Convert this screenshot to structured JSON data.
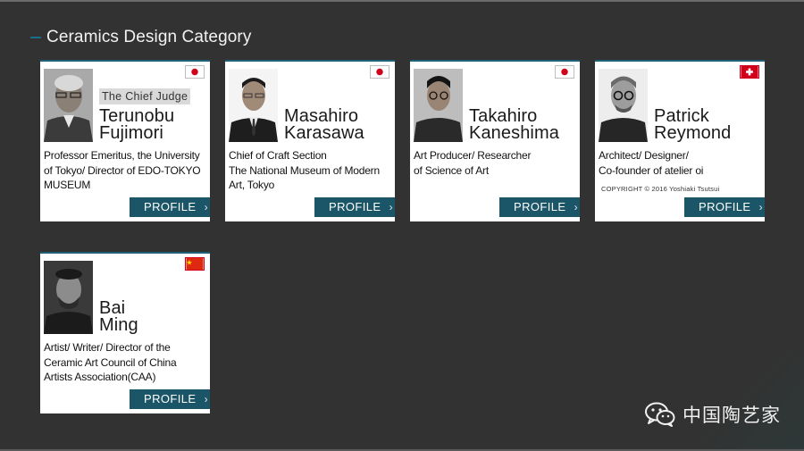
{
  "section": {
    "title": "Ceramics Design Category"
  },
  "cards": [
    {
      "country": "Japan",
      "tag": "The Chief Judge",
      "name_line1": "Terunobu",
      "name_line2": "Fujimori",
      "desc": [
        "Professor Emeritus, the University",
        "of Tokyo/ Director of EDO-TOKYO",
        "MUSEUM"
      ],
      "button": "PROFILE"
    },
    {
      "country": "Japan",
      "name_line1": "Masahiro",
      "name_line2": "Karasawa",
      "desc": [
        "Chief of Craft Section",
        "The National Museum of Modern",
        "Art, Tokyo"
      ],
      "button": "PROFILE"
    },
    {
      "country": "Japan",
      "name_line1": "Takahiro",
      "name_line2": "Kaneshima",
      "desc": [
        "Art Producer/ Researcher",
        "of Science of Art"
      ],
      "button": "PROFILE"
    },
    {
      "country": "Switzerland",
      "name_line1": "Patrick",
      "name_line2": "Reymond",
      "desc": [
        "Architect/ Designer/",
        "Co-founder of atelier oi"
      ],
      "copyright": "COPYRIGHT © 2016 Yoshiaki Tsutsui",
      "button": "PROFILE"
    },
    {
      "country": "China",
      "name_line1": "Bai",
      "name_line2": "Ming",
      "desc": [
        "Artist/ Writer/ Director of the",
        "Ceramic Art Council of China",
        "Artists Association(CAA)"
      ],
      "button": "PROFILE"
    }
  ],
  "watermark": {
    "text": "中国陶艺家",
    "icon": "wechat-icon"
  },
  "colors": {
    "accent": "#1a5568",
    "background": "#323232",
    "flag_red": "#d0021b"
  }
}
